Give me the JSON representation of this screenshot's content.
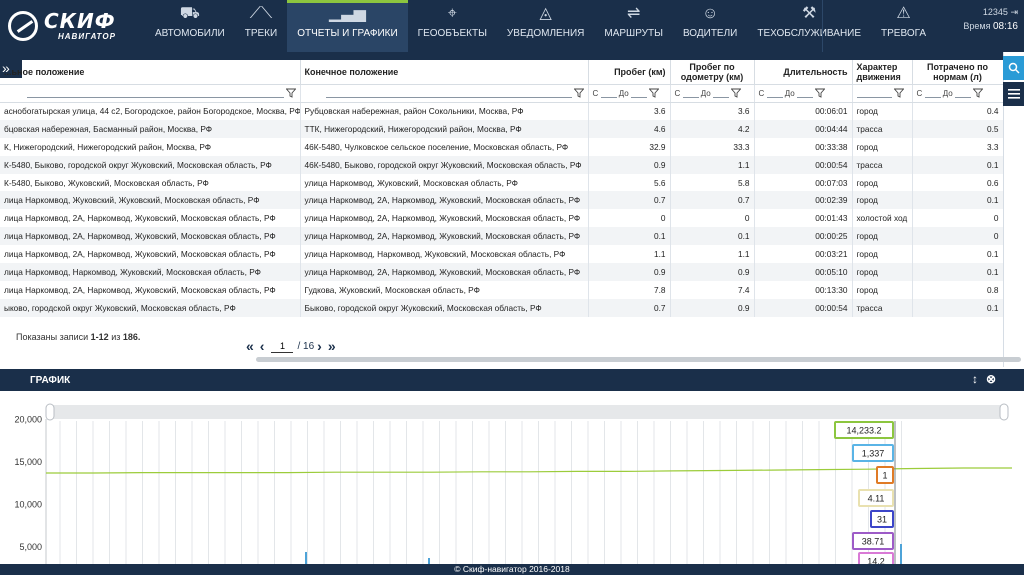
{
  "app": {
    "logo_title": "СКИФ",
    "logo_sub": "НАВИГАТОР"
  },
  "nav": [
    {
      "label": "АВТОМОБИЛИ",
      "icon": "car-icon",
      "glyph": "⛟"
    },
    {
      "label": "ТРЕКИ",
      "icon": "road-icon",
      "glyph": "⟋⟍"
    },
    {
      "label": "ОТЧЕТЫ И ГРАФИКИ",
      "icon": "chart-icon",
      "glyph": "▁▃▅",
      "active": true
    },
    {
      "label": "ГЕООБЪЕКТЫ",
      "icon": "map-pin-icon",
      "glyph": "⌖"
    },
    {
      "label": "УВЕДОМЛЕНИЯ",
      "icon": "bell-icon",
      "glyph": "◬"
    },
    {
      "label": "МАРШРУТЫ",
      "icon": "route-icon",
      "glyph": "⇌"
    },
    {
      "label": "ВОДИТЕЛИ",
      "icon": "person-icon",
      "glyph": "☺"
    },
    {
      "label": "ТЕХОБСЛУЖИВАНИЕ",
      "icon": "wrench-icon",
      "glyph": "⚒"
    },
    {
      "label": "ТРЕВОГА",
      "icon": "alarm-icon",
      "glyph": "⚠"
    }
  ],
  "user": {
    "id": "12345",
    "time_label": "Время",
    "time": "08:16"
  },
  "table": {
    "headers": [
      "...ьное положение",
      "Конечное положение",
      "Пробег (км)",
      "Пробег по одометру (км)",
      "Длительность",
      "Характер движения",
      "Потрачено по нормам (л)"
    ],
    "range_from": "С",
    "range_to": "До",
    "rows": [
      [
        "аснобогатырская улица, 44 с2, Богородское, район Богородское, Москва, РФ",
        "Рубцовская набережная, район Сокольники, Москва, РФ",
        "3.6",
        "3.6",
        "00:06:01",
        "город",
        "0.4"
      ],
      [
        "бцовская набережная, Басманный район, Москва, РФ",
        "ТТК, Нижегородский, Нижегородский район, Москва, РФ",
        "4.6",
        "4.2",
        "00:04:44",
        "трасса",
        "0.5"
      ],
      [
        "К, Нижегородский, Нижегородский район, Москва, РФ",
        "46К-5480, Чулковское сельское поселение, Московская область, РФ",
        "32.9",
        "33.3",
        "00:33:38",
        "город",
        "3.3"
      ],
      [
        "К-5480, Быково, городской округ Жуковский, Московская область, РФ",
        "46К-5480, Быково, городской округ Жуковский, Московская область, РФ",
        "0.9",
        "1.1",
        "00:00:54",
        "трасса",
        "0.1"
      ],
      [
        "К-5480, Быково, Жуковский, Московская область, РФ",
        "улица Наркомвод, Жуковский, Московская область, РФ",
        "5.6",
        "5.8",
        "00:07:03",
        "город",
        "0.6"
      ],
      [
        "лица Наркомвод, Жуковский, Жуковский, Московская область, РФ",
        "улица Наркомвод, 2А, Наркомвод, Жуковский, Московская область, РФ",
        "0.7",
        "0.7",
        "00:02:39",
        "город",
        "0.1"
      ],
      [
        "лица Наркомвод, 2А, Наркомвод, Жуковский, Московская область, РФ",
        "улица Наркомвод, 2А, Наркомвод, Жуковский, Московская область, РФ",
        "0",
        "0",
        "00:01:43",
        "холостой ход",
        "0"
      ],
      [
        "лица Наркомвод, 2А, Наркомвод, Жуковский, Московская область, РФ",
        "улица Наркомвод, 2А, Наркомвод, Жуковский, Московская область, РФ",
        "0.1",
        "0.1",
        "00:00:25",
        "город",
        "0"
      ],
      [
        "лица Наркомвод, 2А, Наркомвод, Жуковский, Московская область, РФ",
        "улица Наркомвод, Наркомвод, Жуковский, Московская область, РФ",
        "1.1",
        "1.1",
        "00:03:21",
        "город",
        "0.1"
      ],
      [
        "лица Наркомвод, Наркомвод, Жуковский, Московская область, РФ",
        "улица Наркомвод, 2А, Наркомвод, Жуковский, Московская область, РФ",
        "0.9",
        "0.9",
        "00:05:10",
        "город",
        "0.1"
      ],
      [
        "лица Наркомвод, 2А, Наркомвод, Жуковский, Московская область, РФ",
        "Гудкова, Жуковский, Московская область, РФ",
        "7.8",
        "7.4",
        "00:13:30",
        "город",
        "0.8"
      ],
      [
        "ыково, городской округ Жуковский, Московская область, РФ",
        "Быково, городской округ Жуковский, Московская область, РФ",
        "0.7",
        "0.9",
        "00:00:54",
        "трасса",
        "0.1"
      ]
    ]
  },
  "pager": {
    "info_prefix": "Показаны записи",
    "range": "1-12",
    "of": "из",
    "total": "186.",
    "page": "1",
    "pages": "/ 16"
  },
  "chart_panel": {
    "title": "ГРАФИК"
  },
  "chart_data": {
    "type": "line",
    "ylim": [
      3000,
      21000
    ],
    "y_ticks": [
      "20,000",
      "15,000",
      "10,000",
      "5,000"
    ],
    "y_tick_values": [
      20000,
      15000,
      10000,
      5000
    ],
    "series": [
      {
        "values": [
          13700,
          13700,
          13750,
          13750,
          13750,
          13750,
          13800,
          13800,
          13800,
          13850,
          13850,
          13900,
          13900,
          13950,
          14000,
          14050,
          14100,
          14150,
          14233.2,
          14300,
          14300
        ],
        "color": "#9ccc3b"
      }
    ],
    "tooltips": [
      {
        "value": "14,233.2",
        "color": "#8cc63f"
      },
      {
        "value": "1,337",
        "color": "#5ab4e6"
      },
      {
        "value": "1",
        "color": "#e07b26"
      },
      {
        "value": "4.11",
        "color": "#e9e1b0"
      },
      {
        "value": "31",
        "color": "#3c45c8"
      },
      {
        "value": "38.71",
        "color": "#9d5bc7"
      },
      {
        "value": "14.2",
        "color": "#d97ad6"
      }
    ]
  },
  "footer": {
    "text": "© Скиф-навигатор 2016-2018"
  }
}
